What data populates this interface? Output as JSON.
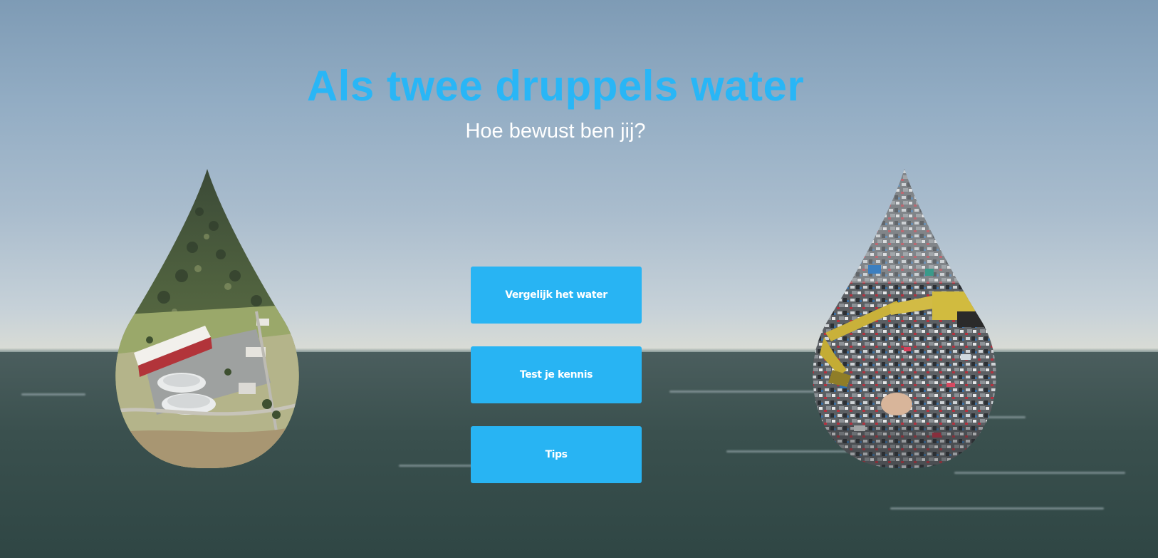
{
  "hero": {
    "title": "Als twee druppels water",
    "subtitle": "Hoe bewust ben jij?"
  },
  "menu": {
    "compare_label": "Vergelijk het water",
    "quiz_label": "Test je kennis",
    "tips_label": "Tips"
  },
  "images": {
    "left_drop": "water-treatment-plant-aerial-photo",
    "right_drop": "landfill-garbage-excavator-photo"
  },
  "colors": {
    "accent": "#29b6f6",
    "button": "#28b4f3",
    "subtitle": "#ffffff"
  }
}
